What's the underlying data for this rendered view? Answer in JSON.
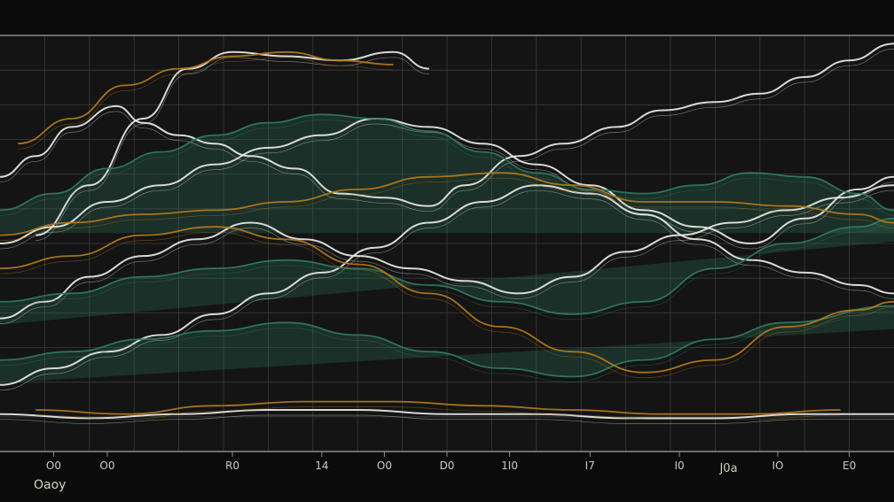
{
  "colors": {
    "background": "#0b0b0b",
    "panel": "#141414",
    "grid": "#3a3a3a",
    "frame": "#8c8c8c",
    "white": "#e9e9e6",
    "green": "#2f7a5e",
    "orange": "#b57a1c",
    "tick_text": "#cfcac0"
  },
  "corner_label": "Oaoy",
  "chart_data": {
    "type": "line",
    "title": "",
    "xlabel": "",
    "ylabel": "",
    "xlim": [
      0,
      100
    ],
    "ylim": [
      0,
      100
    ],
    "grid": true,
    "x_tick_positions": [
      6,
      12,
      26,
      36,
      43,
      50,
      57,
      66,
      76,
      87,
      95
    ],
    "x_tick_labels": [
      "O0",
      "O0",
      "R0",
      "14",
      "O0",
      "D0",
      "1I0",
      "I7",
      "I0",
      "IO",
      "E0"
    ],
    "extra_tick_label": "J0a",
    "series": [
      {
        "color": "white",
        "x": [
          0,
          4,
          8,
          13,
          16,
          20,
          24,
          28,
          33,
          38,
          43,
          48,
          52,
          58,
          63,
          69,
          74,
          80,
          85,
          90,
          95,
          100
        ],
        "y": [
          66,
          71,
          78,
          83,
          79,
          76,
          74,
          71,
          68,
          62,
          61,
          59,
          64,
          71,
          74,
          78,
          82,
          84,
          86,
          90,
          94,
          98
        ]
      },
      {
        "color": "white",
        "x": [
          0,
          6,
          12,
          18,
          24,
          30,
          36,
          42,
          48,
          54,
          60,
          66,
          72,
          78,
          84,
          90,
          96,
          100
        ],
        "y": [
          50,
          54,
          60,
          64,
          69,
          73,
          76,
          80,
          78,
          74,
          69,
          64,
          58,
          54,
          50,
          56,
          63,
          66
        ]
      },
      {
        "color": "white",
        "x": [
          0,
          5,
          10,
          16,
          22,
          28,
          34,
          40,
          46,
          52,
          58,
          64,
          70,
          76,
          82,
          88,
          94,
          100
        ],
        "y": [
          32,
          36,
          42,
          47,
          51,
          55,
          51,
          47,
          44,
          41,
          38,
          42,
          48,
          52,
          55,
          58,
          61,
          64
        ]
      },
      {
        "color": "white",
        "x": [
          0,
          6,
          12,
          18,
          24,
          30,
          36,
          42,
          48,
          54,
          60,
          66,
          72,
          78,
          84,
          90,
          96,
          100
        ],
        "y": [
          16,
          20,
          24,
          28,
          33,
          38,
          43,
          49,
          55,
          60,
          64,
          62,
          57,
          51,
          46,
          43,
          40,
          38
        ]
      },
      {
        "color": "white",
        "x": [
          0,
          10,
          20,
          30,
          40,
          50,
          60,
          70,
          80,
          90,
          100
        ],
        "y": [
          9,
          8,
          9,
          10,
          10,
          9,
          9,
          8,
          8,
          9,
          9
        ]
      },
      {
        "color": "white",
        "x": [
          4,
          10,
          16,
          21,
          26,
          32,
          38,
          44,
          48
        ],
        "y": [
          52,
          64,
          80,
          92,
          96,
          95,
          94,
          96,
          92
        ]
      },
      {
        "color": "green",
        "x": [
          0,
          6,
          12,
          18,
          24,
          30,
          36,
          42,
          48,
          54,
          60,
          66,
          72,
          78,
          84,
          90,
          96,
          100
        ],
        "y": [
          58,
          62,
          68,
          72,
          76,
          79,
          81,
          80,
          77,
          72,
          67,
          63,
          62,
          64,
          67,
          66,
          62,
          58
        ]
      },
      {
        "color": "green",
        "x": [
          0,
          8,
          16,
          24,
          32,
          40,
          48,
          56,
          64,
          72,
          80,
          88,
          96,
          100
        ],
        "y": [
          36,
          38,
          42,
          44,
          46,
          44,
          40,
          36,
          33,
          36,
          44,
          50,
          54,
          56
        ]
      },
      {
        "color": "green",
        "x": [
          0,
          8,
          16,
          24,
          32,
          40,
          48,
          56,
          64,
          72,
          80,
          88,
          100
        ],
        "y": [
          22,
          24,
          27,
          29,
          31,
          28,
          24,
          20,
          18,
          22,
          27,
          31,
          35
        ]
      },
      {
        "color": "orange",
        "x": [
          0,
          8,
          16,
          24,
          32,
          40,
          48,
          56,
          64,
          72,
          80,
          88,
          96,
          100
        ],
        "y": [
          52,
          55,
          57,
          58,
          60,
          63,
          66,
          67,
          64,
          60,
          60,
          59,
          57,
          55
        ]
      },
      {
        "color": "orange",
        "x": [
          2,
          8,
          14,
          20,
          26,
          32,
          38,
          44
        ],
        "y": [
          74,
          80,
          88,
          92,
          95,
          96,
          94,
          93
        ]
      },
      {
        "color": "orange",
        "x": [
          0,
          8,
          16,
          24,
          32,
          40,
          48,
          56,
          64,
          72,
          80,
          88,
          96,
          100
        ],
        "y": [
          44,
          47,
          52,
          54,
          51,
          45,
          38,
          30,
          24,
          19,
          22,
          30,
          34,
          36
        ]
      },
      {
        "color": "orange",
        "x": [
          4,
          14,
          24,
          34,
          44,
          54,
          64,
          74,
          84,
          94
        ],
        "y": [
          10,
          9,
          11,
          12,
          12,
          11,
          10,
          9,
          9,
          10
        ]
      }
    ]
  }
}
